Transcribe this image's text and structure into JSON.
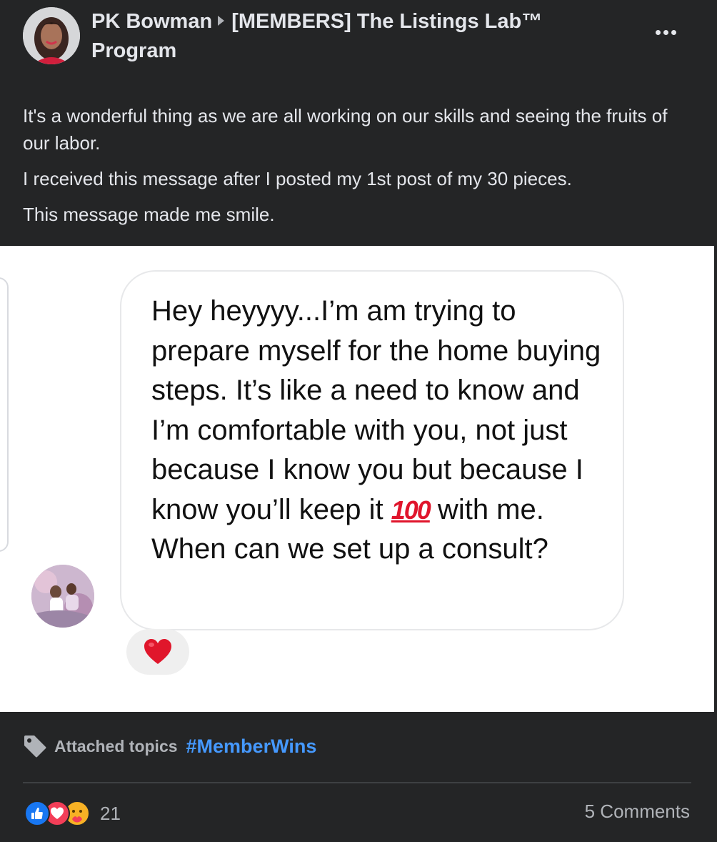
{
  "header": {
    "author": "PK Bowman",
    "group": "[MEMBERS] The Listings Lab™ Program",
    "more_icon": "more-options-icon"
  },
  "body": {
    "paragraphs": [
      "It's a wonderful thing as we are all working on our skills and seeing the fruits of our labor.",
      "I received this message after I posted my 1st post of my 30 pieces.",
      "This message made me smile."
    ]
  },
  "image": {
    "message_before": "Hey heyyyy...I’m am trying to prepare myself for the home buying steps.  It’s like a need to know and I’m comfortable with you, not just because I know you but because I know you’ll keep it ",
    "emoji_100": "100",
    "message_after": " with me.  When can we set up a consult?",
    "reaction_icon": "heart-icon"
  },
  "topics": {
    "label": "Attached topics",
    "tag": "#MemberWins",
    "icon": "tag-icon"
  },
  "footer": {
    "reactions": [
      "like",
      "love",
      "care"
    ],
    "reaction_count": "21",
    "comments": "5 Comments"
  },
  "colors": {
    "background": "#242526",
    "text": "#e4e6eb",
    "secondary_text": "#b0b3b8",
    "link": "#4599ff",
    "like": "#1877f2",
    "love": "#f33e58",
    "care": "#f7b125"
  }
}
